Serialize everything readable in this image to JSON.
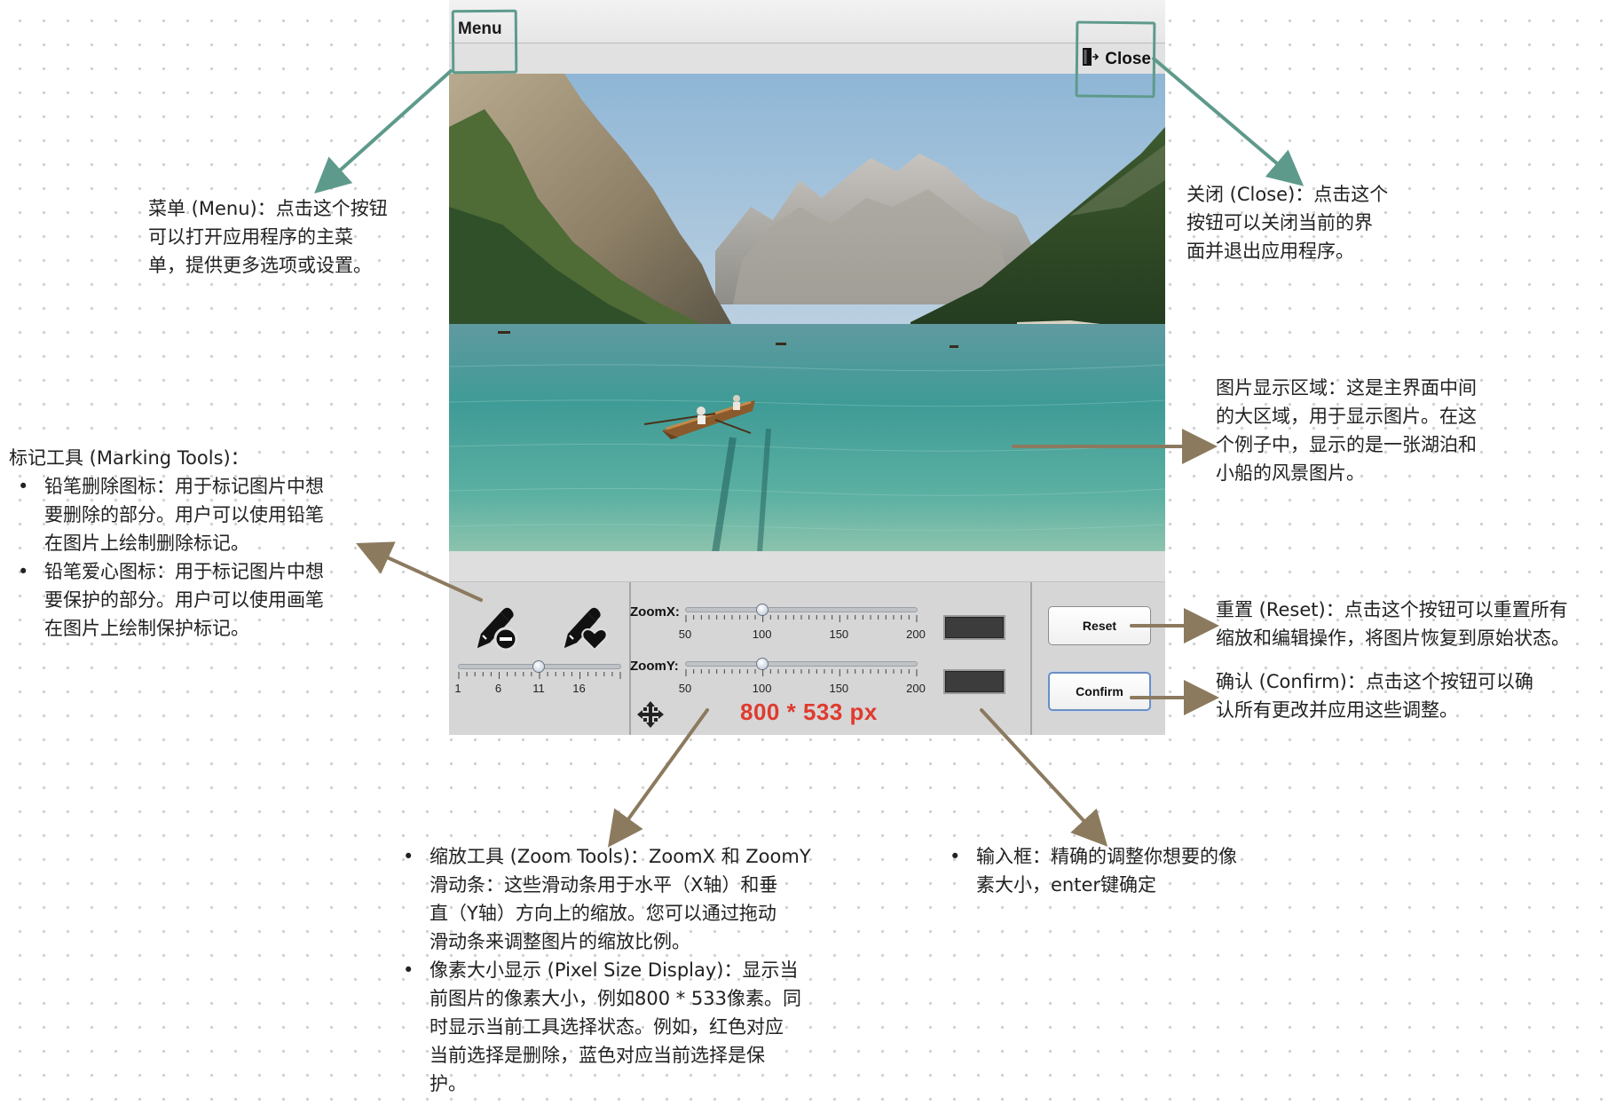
{
  "app": {
    "menu_label": "Menu",
    "close_label": "Close",
    "zoom_x_label": "ZoomX:",
    "zoom_y_label": "ZoomY:",
    "zoom_ticks": [
      "50",
      "100",
      "150",
      "200"
    ],
    "brush_ticks": [
      "1",
      "6",
      "11",
      "16"
    ],
    "zoom_x_value": 100,
    "zoom_y_value": 100,
    "brush_size_value": 11,
    "size_display": "800 * 533 px",
    "reset_label": "Reset",
    "confirm_label": "Confirm",
    "zoom_x_input": "",
    "zoom_y_input": "",
    "colors": {
      "highlight": "#5e9a8c",
      "annotation_arrow": "#8c7a5f",
      "size_display": "#e03a2e"
    },
    "icons": [
      "pencil-delete-icon",
      "pencil-heart-icon",
      "move-icon",
      "close-door-icon"
    ]
  },
  "annotations": {
    "menu": {
      "lines": [
        "菜单 (Menu)：点击这个按钮",
        "可以打开应用程序的主菜",
        "单，提供更多选项或设置。"
      ]
    },
    "close": {
      "lines": [
        "关闭 (Close)：点击这个",
        "按钮可以关闭当前的界",
        "面并退出应用程序。"
      ]
    },
    "image_area": {
      "lines": [
        "图片显示区域：这是主界面中间",
        "的大区域，用于显示图片。在这",
        "个例子中，显示的是一张湖泊和",
        "小船的风景图片。"
      ]
    },
    "marking_tools": {
      "title": "标记工具 (Marking Tools)：",
      "items": [
        [
          "铅笔删除图标：用于标记图片中想",
          "要删除的部分。用户可以使用铅笔",
          "在图片上绘制删除标记。"
        ],
        [
          "铅笔爱心图标：用于标记图片中想",
          "要保护的部分。用户可以使用画笔",
          "在图片上绘制保护标记。"
        ]
      ]
    },
    "reset": {
      "lines": [
        "重置 (Reset)：点击这个按钮可以重置所有",
        "缩放和编辑操作，将图片恢复到原始状态。"
      ]
    },
    "confirm": {
      "lines": [
        "确认 (Confirm)：点击这个按钮可以确",
        "认所有更改并应用这些调整。"
      ]
    },
    "zoom_tools": {
      "items": [
        [
          "缩放工具 (Zoom Tools)：ZoomX 和 ZoomY",
          "滑动条：这些滑动条用于水平（X轴）和垂",
          "直（Y轴）方向上的缩放。您可以通过拖动",
          "滑动条来调整图片的缩放比例。"
        ],
        [
          "像素大小显示 (Pixel Size Display)：显示当",
          "前图片的像素大小，例如800 * 533像素。同",
          "时显示当前工具选择状态。例如，红色对应",
          "当前选择是删除，蓝色对应当前选择是保",
          "护。"
        ]
      ]
    },
    "input_box": {
      "items": [
        [
          "输入框：精确的调整你想要的像",
          "素大小，enter键确定"
        ]
      ]
    }
  }
}
